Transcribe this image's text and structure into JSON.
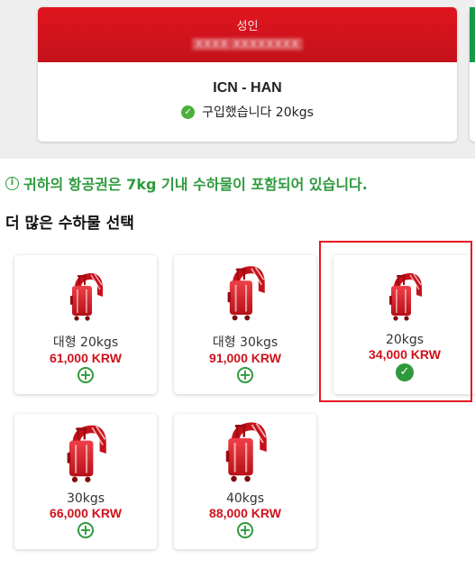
{
  "passenger": {
    "type": "성인",
    "name_masked": "XXXX XXXXXXXX",
    "route": "ICN - HAN",
    "purchased_text": "구입했습니다 20kgs"
  },
  "notice": {
    "icon": "info-icon",
    "text": "귀하의 항공권은 7kg 기내 수하물이 포함되어 있습니다."
  },
  "section_title": "더 많은 수하물 선택",
  "options": [
    {
      "label": "대형 20kgs",
      "price": "61,000 KRW",
      "selected": false
    },
    {
      "label": "대형 30kgs",
      "price": "91,000 KRW",
      "selected": false
    },
    {
      "label": "20kgs",
      "price": "34,000 KRW",
      "selected": true
    },
    {
      "label": "30kgs",
      "price": "66,000 KRW",
      "selected": false
    },
    {
      "label": "40kgs",
      "price": "88,000 KRW",
      "selected": false
    }
  ],
  "colors": {
    "brand_red": "#d0111b",
    "success_green": "#2e9a3d"
  }
}
